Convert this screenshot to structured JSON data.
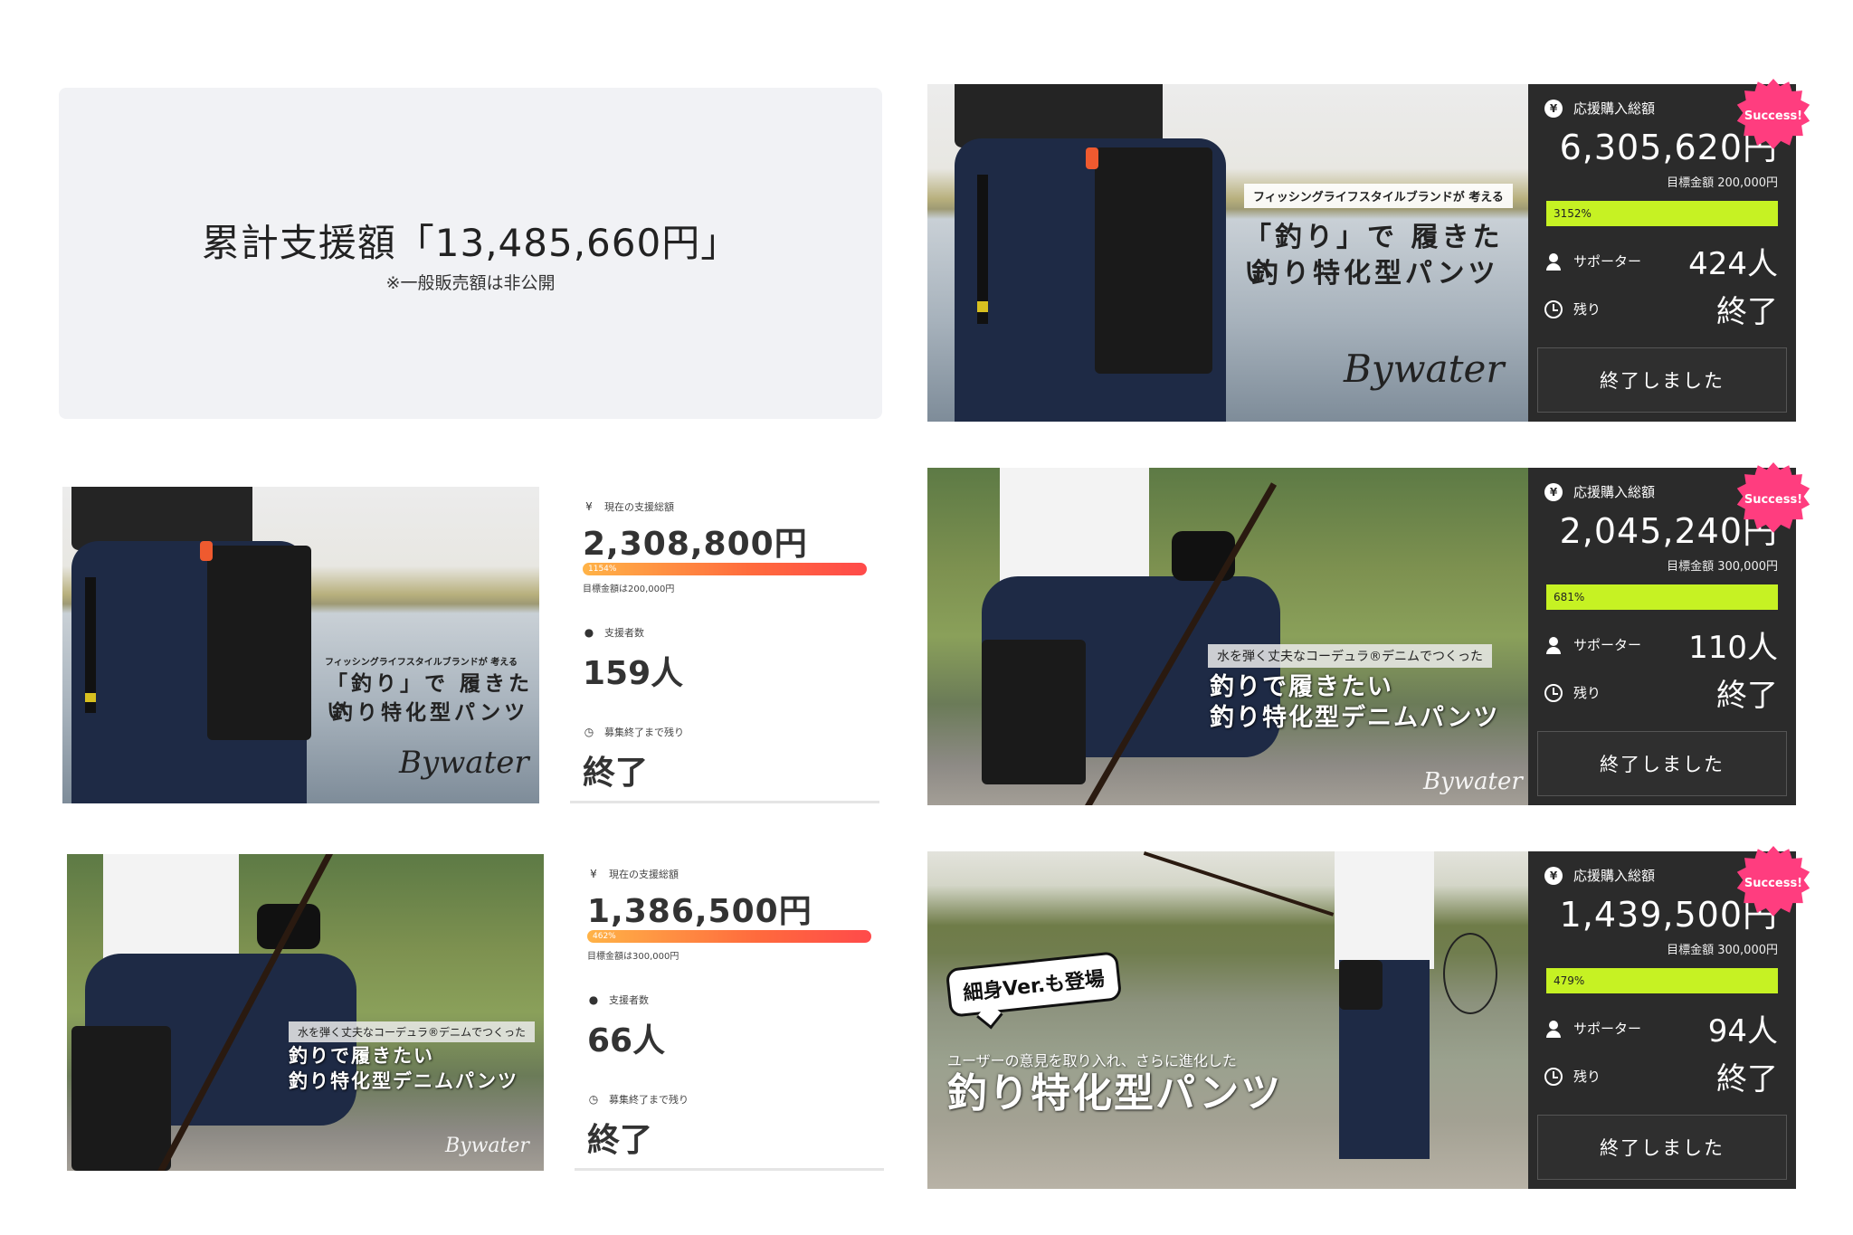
{
  "summary": {
    "title": "累計支援額「13,485,660円」",
    "note": "※一般販売額は非公開"
  },
  "dark_cards": [
    {
      "total_label": "応援購入総額",
      "total": "6,305,620円",
      "goal": "目標金額 200,000円",
      "percent": "3152%",
      "supporters_label": "サポーター",
      "supporters": "424人",
      "remaining_label": "残り",
      "remaining": "終了",
      "button": "終了しました",
      "badge": "Success!",
      "photo": {
        "label": "フィッシングライフスタイルブランドが 考える",
        "headline_1": "「釣り」で 履きたい",
        "headline_2": "釣り特化型パンツ",
        "logo": "Bywater"
      }
    },
    {
      "total_label": "応援購入総額",
      "total": "2,045,240円",
      "goal": "目標金額 300,000円",
      "percent": "681%",
      "supporters_label": "サポーター",
      "supporters": "110人",
      "remaining_label": "残り",
      "remaining": "終了",
      "button": "終了しました",
      "badge": "Success!",
      "photo": {
        "label": "水を弾く丈夫なコーデュラ®デニムでつくった",
        "headline_1": "釣りで履きたい",
        "headline_2": "釣り特化型デニムパンツ",
        "logo": "Bywater"
      }
    },
    {
      "total_label": "応援購入総額",
      "total": "1,439,500円",
      "goal": "目標金額 300,000円",
      "percent": "479%",
      "supporters_label": "サポーター",
      "supporters": "94人",
      "remaining_label": "残り",
      "remaining": "終了",
      "button": "終了しました",
      "badge": "Success!",
      "photo": {
        "bubble": "細身Ver.も登場",
        "sub": "ユーザーの意見を取り入れ、さらに進化した",
        "headline": "釣り特化型パンツ"
      }
    }
  ],
  "light_cards": [
    {
      "total_label": "現在の支援総額",
      "total": "2,308,800円",
      "percent": "1154%",
      "goal": "目標金額は200,000円",
      "supporters_label": "支援者数",
      "supporters": "159人",
      "remaining_label": "募集終了まで残り",
      "remaining": "終了",
      "photo": {
        "label": "フィッシングライフスタイルブランドが 考える",
        "headline_1": "「釣り」で 履きたい",
        "headline_2": "釣り特化型パンツ",
        "logo": "Bywater"
      }
    },
    {
      "total_label": "現在の支援総額",
      "total": "1,386,500円",
      "percent": "462%",
      "goal": "目標金額は300,000円",
      "supporters_label": "支援者数",
      "supporters": "66人",
      "remaining_label": "募集終了まで残り",
      "remaining": "終了",
      "photo": {
        "label": "水を弾く丈夫なコーデュラ®デニムでつくった",
        "headline_1": "釣りで履きたい",
        "headline_2": "釣り特化型デニムパンツ",
        "logo": "Bywater"
      }
    }
  ],
  "icons": {
    "yen": "¥",
    "user": "user-icon",
    "clock": "clock-icon"
  },
  "colors": {
    "dark_panel": "#2b2b2b",
    "progress_lime": "#c6f223",
    "success_badge": "#ff3d7f",
    "progress_gradient_start": "#ffb347",
    "progress_gradient_end": "#ff4a4a",
    "summary_bg": "#f1f2f5"
  }
}
